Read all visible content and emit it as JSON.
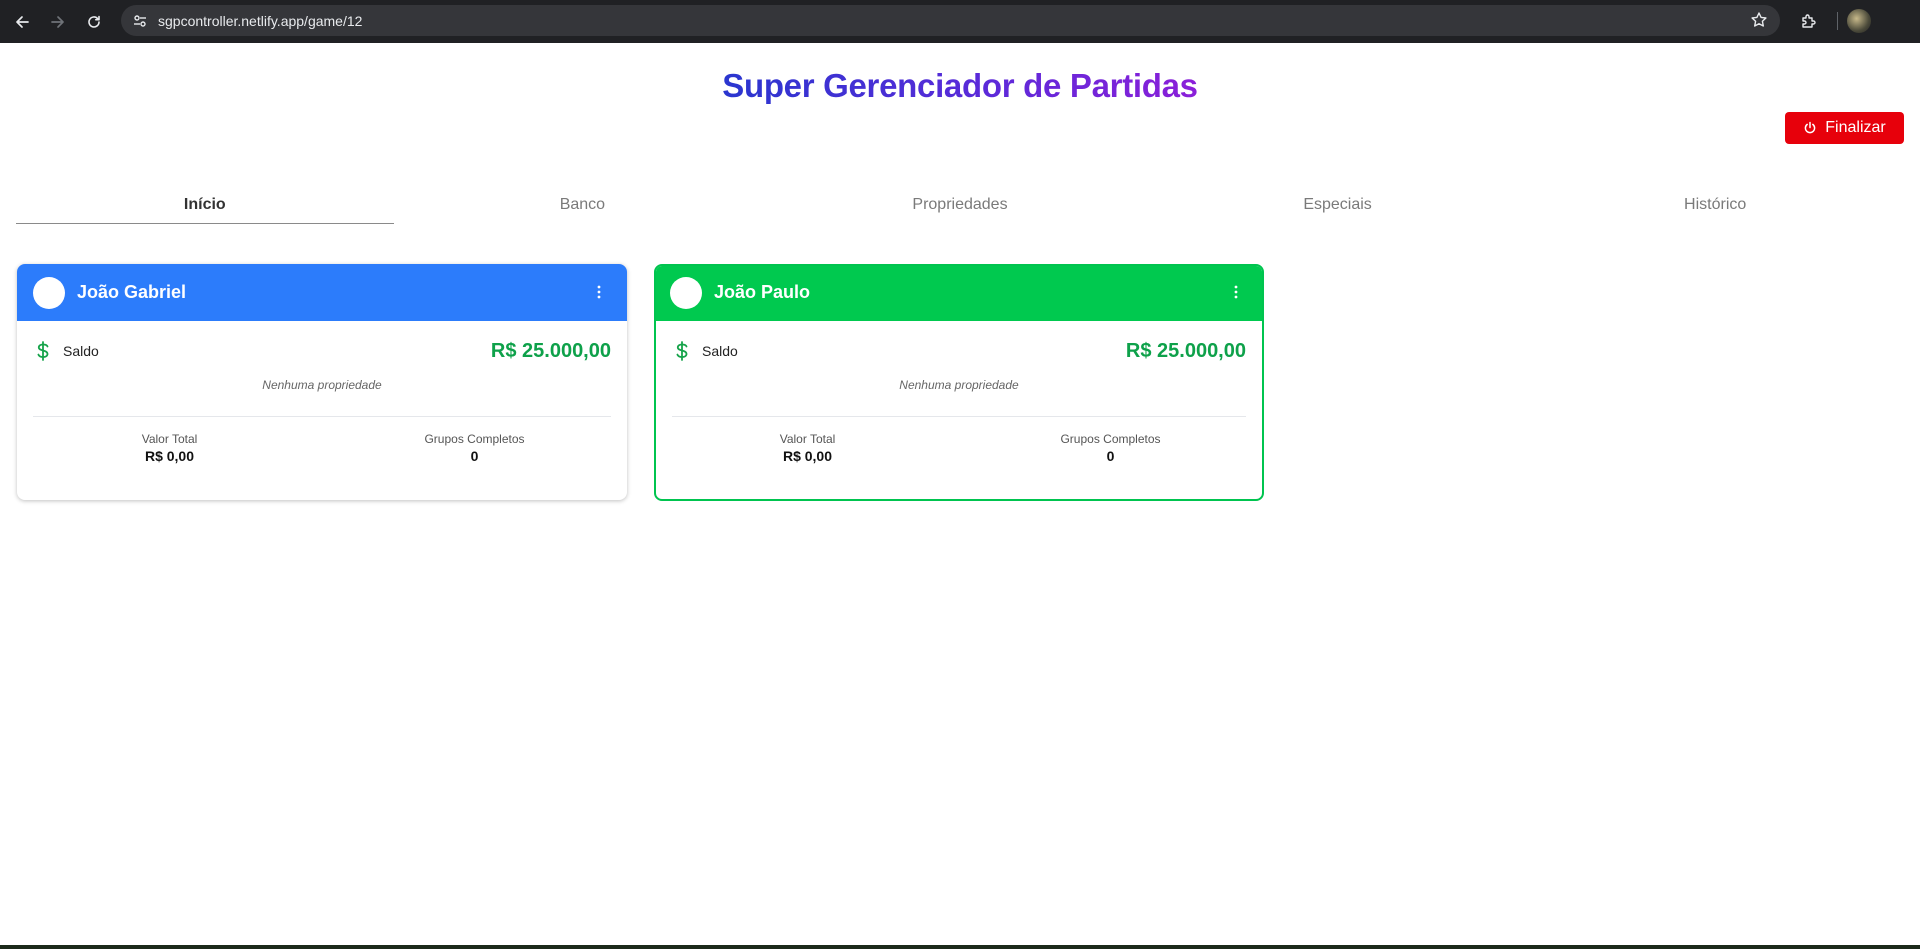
{
  "browser": {
    "url": "sgpcontroller.netlify.app/game/12"
  },
  "page": {
    "title": "Super Gerenciador de Partidas",
    "finalize_label": "Finalizar",
    "colors": {
      "accent_red": "#e7000b",
      "title_gradient_start": "#2a36cf",
      "title_gradient_end": "#8b1fd9"
    }
  },
  "tabs": [
    {
      "label": "Início",
      "active": true
    },
    {
      "label": "Banco",
      "active": false
    },
    {
      "label": "Propriedades",
      "active": false
    },
    {
      "label": "Especiais",
      "active": false
    },
    {
      "label": "Histórico",
      "active": false
    }
  ],
  "players": [
    {
      "name": "João Gabriel",
      "color": "#2c7cfb",
      "saldo_label": "Saldo",
      "saldo_value": "R$ 25.000,00",
      "properties_text": "Nenhuma propriedade",
      "total_label": "Valor Total",
      "total_value": "R$ 0,00",
      "groups_label": "Grupos Completos",
      "groups_value": "0"
    },
    {
      "name": "João Paulo",
      "color": "#00c94f",
      "selected": true,
      "saldo_label": "Saldo",
      "saldo_value": "R$ 25.000,00",
      "properties_text": "Nenhuma propriedade",
      "total_label": "Valor Total",
      "total_value": "R$ 0,00",
      "groups_label": "Grupos Completos",
      "groups_value": "0"
    }
  ]
}
